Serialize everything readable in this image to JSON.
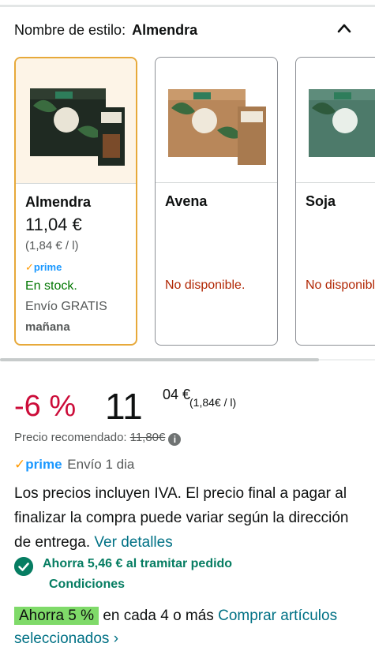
{
  "style_selector": {
    "label": "Nombre de estilo:",
    "value": "Almendra",
    "collapse_icon": "chevron-up-icon"
  },
  "cards": [
    {
      "name": "Almendra",
      "price": "11,04 €",
      "unit_price": "(1,84 € / l)",
      "prime": "prime",
      "stock": "En stock.",
      "shipping": "Envío GRATIS",
      "shipping_day": "mañana",
      "selected": true
    },
    {
      "name": "Avena",
      "availability": "No disponible."
    },
    {
      "name": "Soja",
      "availability": "No disponible."
    }
  ],
  "buybox": {
    "discount": "-6 %",
    "price_whole": "11",
    "price_fraction": "04 €",
    "unit_price": "(1,84€ / l)",
    "recommended_label": "Precio recomendado:",
    "recommended_price": "11,80€",
    "prime_label": "prime",
    "prime_shipping": "Envío 1 dia",
    "vat_text": "Los precios incluyen IVA. El precio final a pagar al finalizar la compra puede variar según la dirección de entrega.",
    "vat_link": "Ver detalles",
    "coupon_text": "Ahorra 5,46 € al tramitar pedido",
    "coupon_link": "Condiciones",
    "promo_badge": "Ahorra 5 %",
    "promo_text": "en cada 4 o más",
    "promo_link": "Comprar artículos seleccionados ›"
  },
  "colors": {
    "discount": "#cc0c39",
    "link": "#007185",
    "in_stock": "#007600",
    "unavailable": "#b12704",
    "selected_border": "#e7a93a",
    "coupon_green": "#067d62",
    "promo_badge_bg": "#7fda69",
    "prime_blue": "#1a98ff"
  }
}
